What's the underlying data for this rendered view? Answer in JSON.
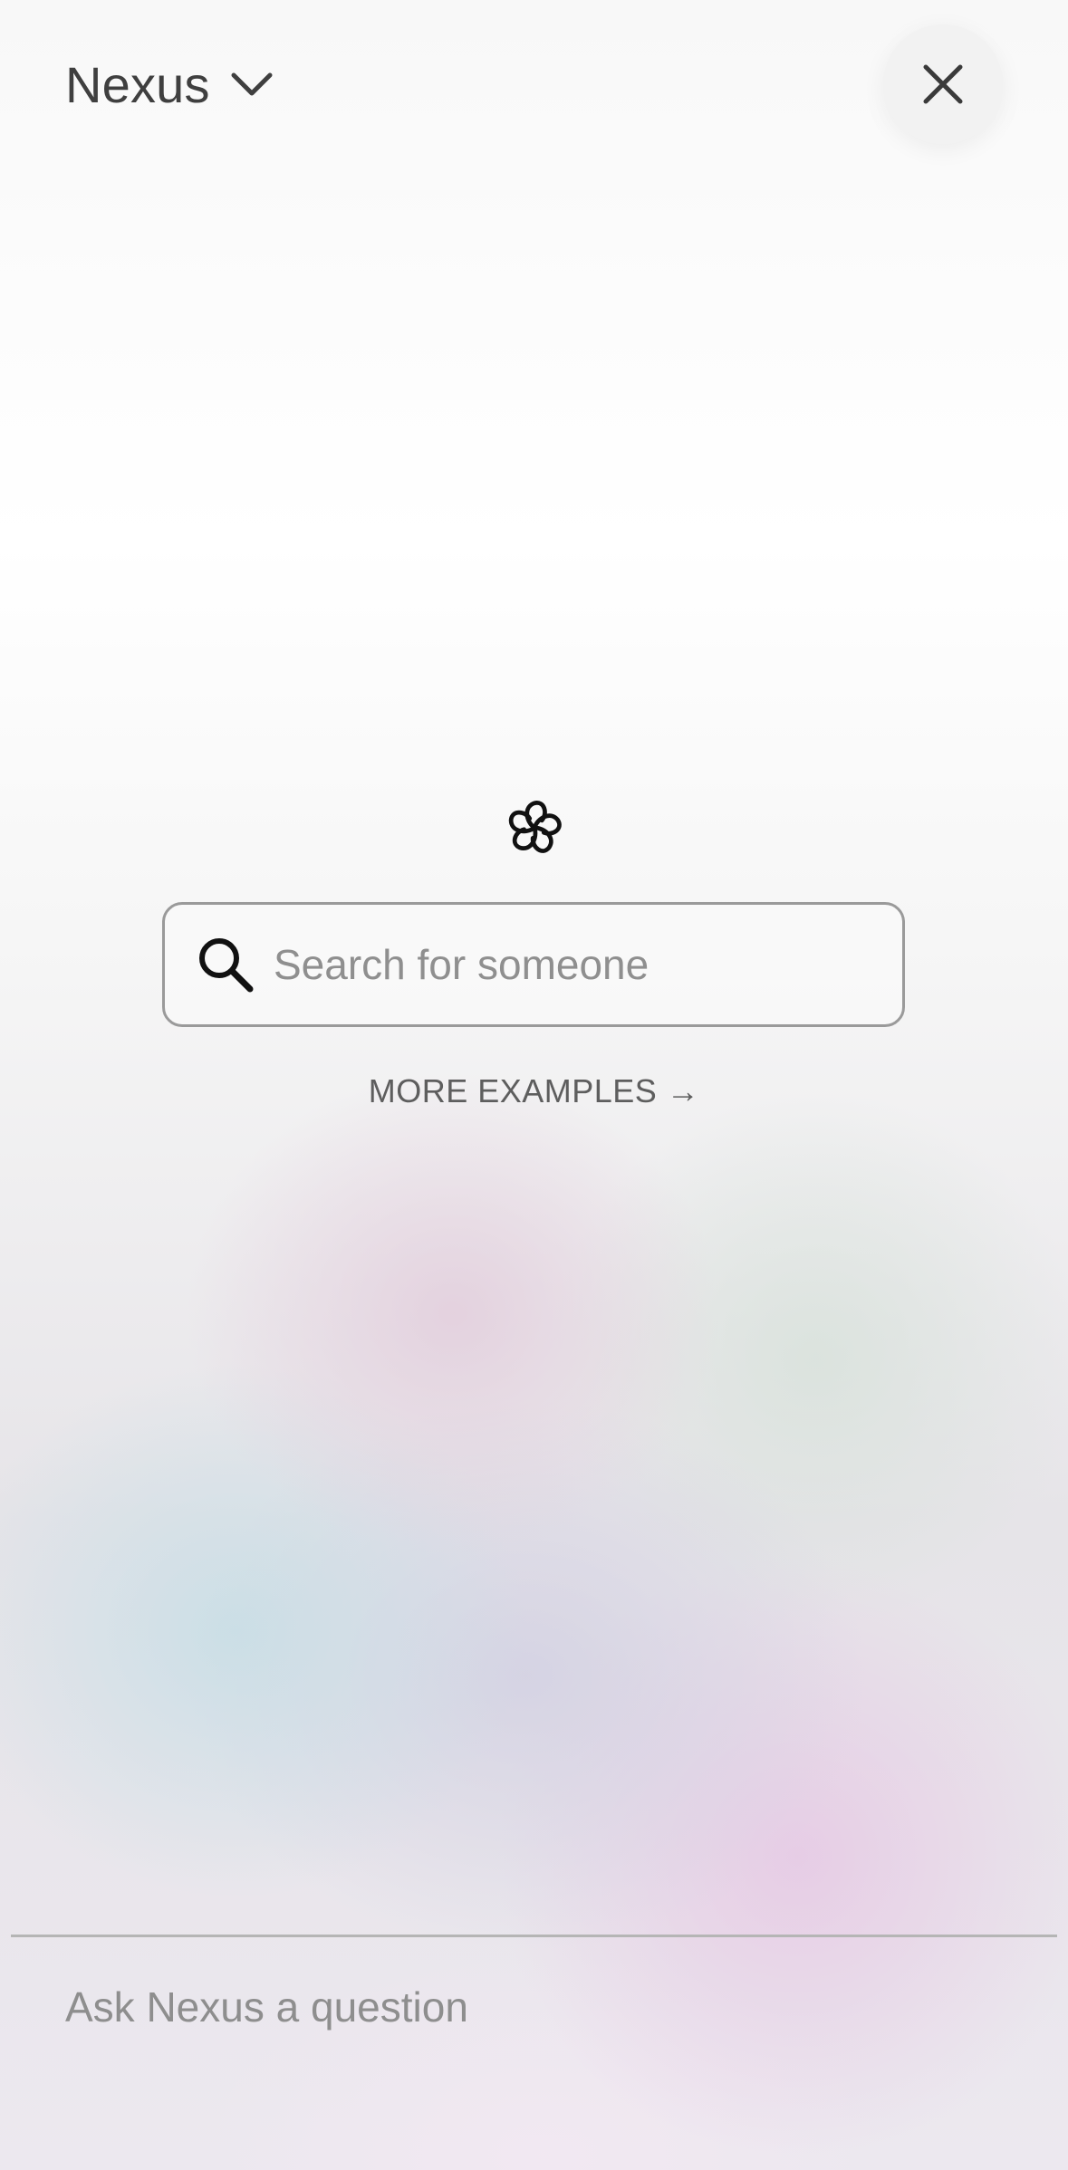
{
  "header": {
    "title": "Nexus",
    "dropdown_icon": "chevron-down-icon"
  },
  "close_button": {
    "icon": "close-icon"
  },
  "logo": {
    "icon": "flower-logo-icon"
  },
  "search": {
    "placeholder": "Search for someone",
    "value": "",
    "icon": "search-icon"
  },
  "more_examples": {
    "label": "MORE EXAMPLES →"
  },
  "composer": {
    "placeholder": "Ask Nexus a question",
    "value": ""
  },
  "colors": {
    "title_text": "#3f3f3f",
    "placeholder_text": "#8f8f8f",
    "border": "#9a9a9a",
    "link_text": "#5e5e5e"
  }
}
